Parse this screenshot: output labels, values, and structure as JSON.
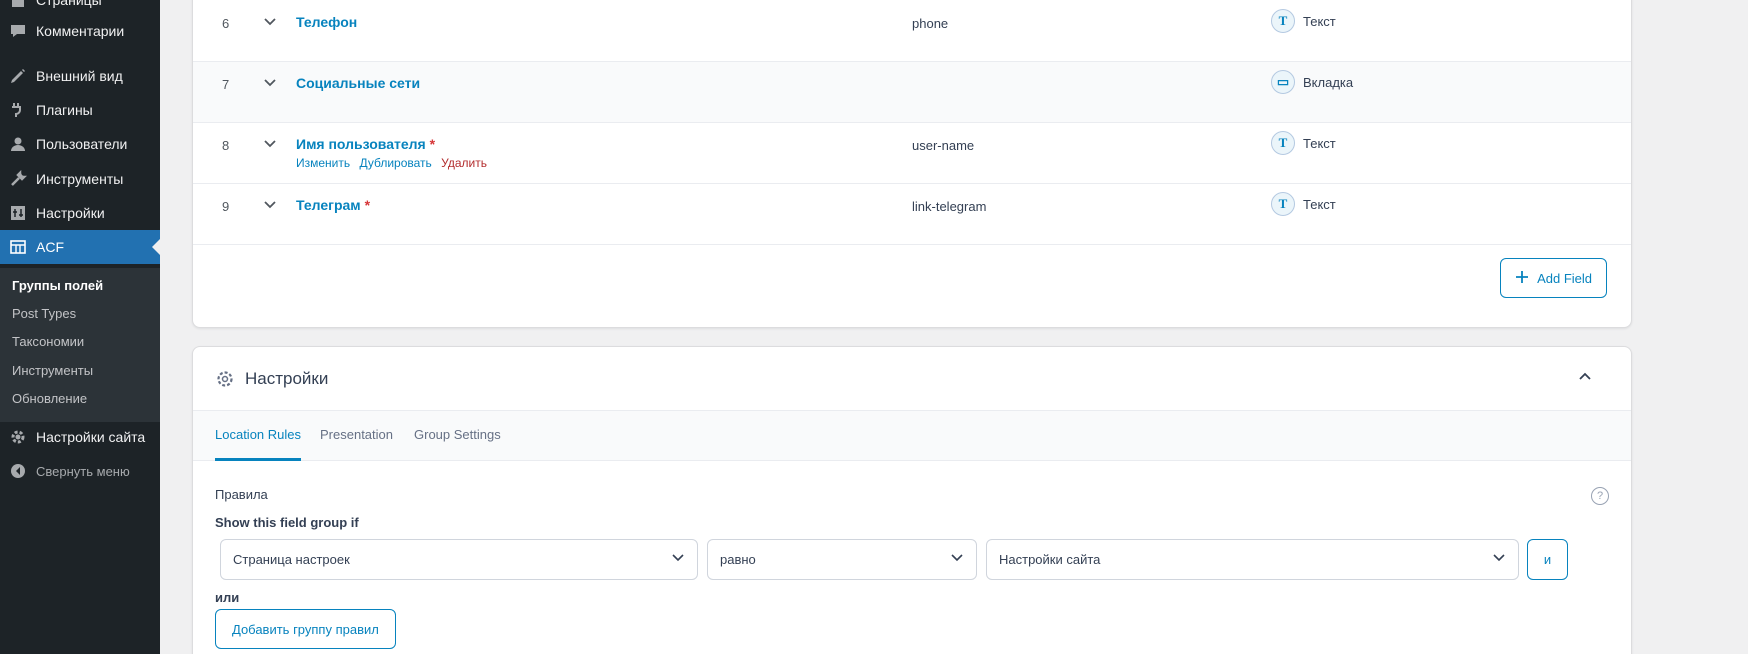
{
  "sidebar": {
    "items": [
      {
        "label": "Страницы",
        "icon": "pages-icon"
      },
      {
        "label": "Комментарии",
        "icon": "comments-icon"
      },
      {
        "label": "Внешний вид",
        "icon": "appearance-icon"
      },
      {
        "label": "Плагины",
        "icon": "plugins-icon"
      },
      {
        "label": "Пользователи",
        "icon": "users-icon"
      },
      {
        "label": "Инструменты",
        "icon": "tools-icon"
      },
      {
        "label": "Настройки",
        "icon": "settings-icon"
      },
      {
        "label": "ACF",
        "icon": "acf-icon"
      }
    ],
    "submenu": [
      "Группы полей",
      "Post Types",
      "Таксономии",
      "Инструменты",
      "Обновление"
    ],
    "site_settings": "Настройки сайта",
    "collapse": "Свернуть меню"
  },
  "fields": [
    {
      "num": "6",
      "label": "Телефон",
      "required": "",
      "name": "phone",
      "type": "Текст",
      "type_icon": "text-icon",
      "type_glyph": "T"
    },
    {
      "num": "7",
      "label": "Социальные сети",
      "required": "",
      "name": "",
      "type": "Вкладка",
      "type_icon": "tab-icon",
      "type_glyph": "▭"
    },
    {
      "num": "8",
      "label": "Имя пользователя",
      "required": "*",
      "name": "user-name",
      "type": "Текст",
      "type_icon": "text-icon",
      "type_glyph": "T"
    },
    {
      "num": "9",
      "label": "Телеграм",
      "required": "*",
      "name": "link-telegram",
      "type": "Текст",
      "type_icon": "text-icon",
      "type_glyph": "T"
    }
  ],
  "row_actions": {
    "edit": "Изменить",
    "duplicate": "Дублировать",
    "delete": "Удалить"
  },
  "add_field": "Add Field",
  "settings": {
    "title": "Настройки",
    "tabs": [
      "Location Rules",
      "Presentation",
      "Group Settings"
    ],
    "rules_label": "Правила",
    "help": "?",
    "show_if": "Show this field group if",
    "param": "Страница настроек",
    "operator": "равно",
    "value": "Настройки сайта",
    "and": "и",
    "or": "или",
    "add_group": "Добавить группу правил"
  },
  "colors": {
    "accent": "#0783be",
    "wp_blue": "#2271b1",
    "sidebar": "#1d2327",
    "required": "#d63638"
  }
}
